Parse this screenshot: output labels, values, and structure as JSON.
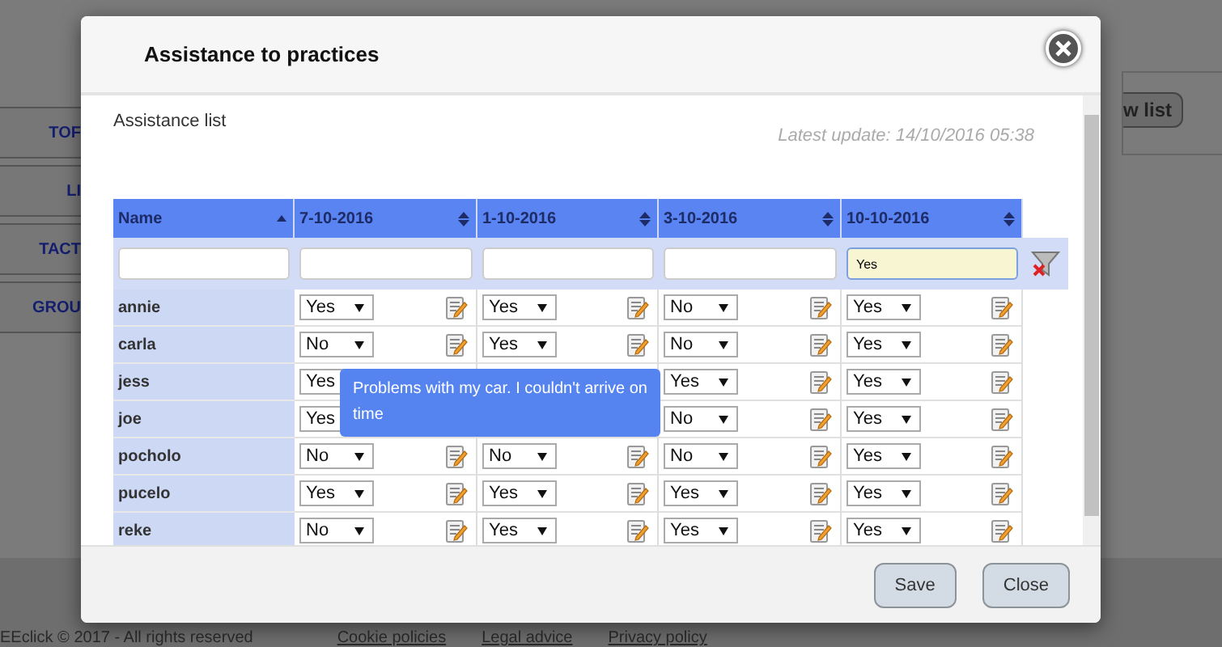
{
  "background": {
    "sidebar": [
      {
        "label": "TOF"
      },
      {
        "label": "LI"
      },
      {
        "label": "TACT"
      },
      {
        "label": "GROU"
      }
    ],
    "view_button": "w list",
    "footer": {
      "copyright": "EEclick © 2017 - All rights reserved",
      "links": [
        "Cookie policies",
        "Legal advice",
        "Privacy policy"
      ]
    }
  },
  "dialog": {
    "title": "Assistance to practices",
    "subtitle": "Assistance list",
    "latest_update": "Latest update: 14/10/2016 05:38",
    "table": {
      "columns": [
        {
          "label": "Name",
          "sorted": true
        },
        {
          "label": "7-10-2016",
          "sorted": false
        },
        {
          "label": "1-10-2016",
          "sorted": false
        },
        {
          "label": "3-10-2016",
          "sorted": false
        },
        {
          "label": "10-10-2016",
          "sorted": false
        }
      ],
      "filters": [
        {
          "active": false
        },
        {
          "active": false
        },
        {
          "active": false
        },
        {
          "active": false
        },
        {
          "value": "Yes",
          "active": true
        }
      ],
      "rows": [
        {
          "cells": [
            {
              "kind": "name",
              "value": "annie"
            },
            {
              "kind": "choice",
              "value": "Yes",
              "icon": true
            },
            {
              "kind": "choice",
              "value": "Yes",
              "icon": true
            },
            {
              "kind": "choice",
              "value": "No",
              "icon": true
            },
            {
              "kind": "choice",
              "value": "Yes",
              "icon": true
            }
          ]
        },
        {
          "cells": [
            {
              "kind": "name",
              "value": "carla"
            },
            {
              "kind": "choice",
              "value": "No",
              "icon": true
            },
            {
              "kind": "choice",
              "value": "Yes",
              "icon": true
            },
            {
              "kind": "choice",
              "value": "No",
              "icon": true
            },
            {
              "kind": "choice",
              "value": "Yes",
              "icon": true
            }
          ]
        },
        {
          "cells": [
            {
              "kind": "name",
              "value": "jess"
            },
            {
              "kind": "choice",
              "value": "Yes",
              "icon": false
            },
            {
              "kind": "choice",
              "icon": false
            },
            {
              "kind": "choice",
              "value": "Yes",
              "icon": true
            },
            {
              "kind": "choice",
              "value": "Yes",
              "icon": true
            }
          ]
        },
        {
          "cells": [
            {
              "kind": "name",
              "value": "joe"
            },
            {
              "kind": "choice",
              "value": "Yes",
              "icon": false
            },
            {
              "kind": "choice",
              "icon": false
            },
            {
              "kind": "choice",
              "value": "No",
              "icon": true
            },
            {
              "kind": "choice",
              "value": "Yes",
              "icon": true
            }
          ]
        },
        {
          "cells": [
            {
              "kind": "name",
              "value": "pocholo"
            },
            {
              "kind": "choice",
              "value": "No",
              "icon": true
            },
            {
              "kind": "choice",
              "value": "No",
              "icon": true
            },
            {
              "kind": "choice",
              "value": "No",
              "icon": true
            },
            {
              "kind": "choice",
              "value": "Yes",
              "icon": true
            }
          ]
        },
        {
          "cells": [
            {
              "kind": "name",
              "value": "pucelo"
            },
            {
              "kind": "choice",
              "value": "Yes",
              "icon": true
            },
            {
              "kind": "choice",
              "value": "Yes",
              "icon": true
            },
            {
              "kind": "choice",
              "value": "Yes",
              "icon": true
            },
            {
              "kind": "choice",
              "value": "Yes",
              "icon": true
            }
          ]
        },
        {
          "cells": [
            {
              "kind": "name",
              "value": "reke"
            },
            {
              "kind": "choice",
              "value": "No",
              "icon": true
            },
            {
              "kind": "choice",
              "value": "Yes",
              "icon": true
            },
            {
              "kind": "choice",
              "value": "Yes",
              "icon": true
            },
            {
              "kind": "choice",
              "value": "Yes",
              "icon": true
            }
          ]
        }
      ]
    },
    "tooltip": "Problems with my car. I couldn't arrive on time",
    "buttons": [
      "Save",
      "Close"
    ]
  }
}
